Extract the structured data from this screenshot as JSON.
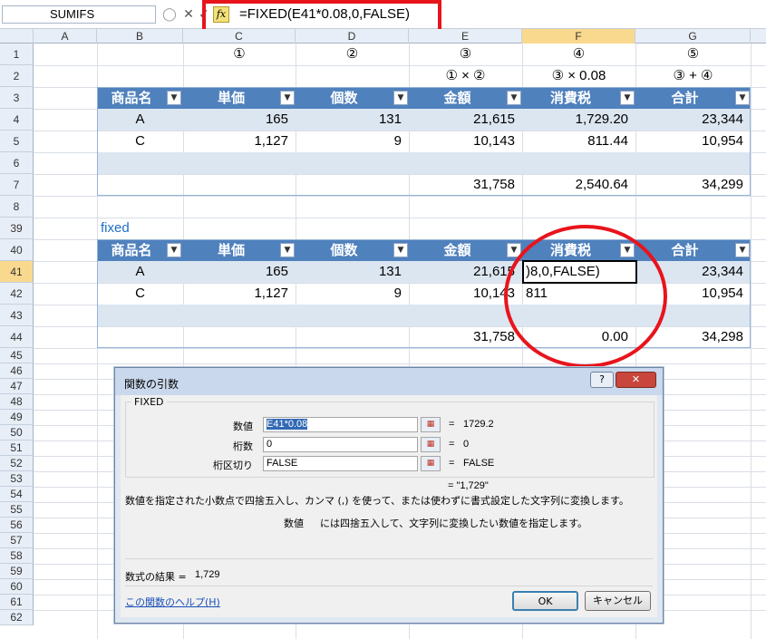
{
  "formula_bar": {
    "name_box": "SUMIFS",
    "cancel_icon": "✕",
    "enter_icon": "✓",
    "fx_label": "fx",
    "formula": "=FIXED(E41*0.08,0,FALSE)"
  },
  "columns": [
    "A",
    "B",
    "C",
    "D",
    "E",
    "F",
    "G"
  ],
  "rows": [
    "1",
    "2",
    "3",
    "4",
    "5",
    "6",
    "7",
    "8",
    "39",
    "40",
    "41",
    "42",
    "43",
    "44",
    "45",
    "46",
    "47",
    "48",
    "49",
    "50",
    "51",
    "52",
    "53",
    "54",
    "55",
    "56",
    "57",
    "58",
    "59",
    "60",
    "61",
    "62"
  ],
  "notes": {
    "row1": [
      "①",
      "②",
      "③",
      "④",
      "⑤"
    ],
    "row2": [
      "① × ②",
      "③ × 0.08",
      "③ + ④"
    ]
  },
  "table1": {
    "headers": [
      "商品名",
      "単価",
      "個数",
      "金額",
      "消費税",
      "合計"
    ],
    "rows": [
      [
        "A",
        "165",
        "131",
        "21,615",
        "1,729.20",
        "23,344"
      ],
      [
        "C",
        "1,127",
        "9",
        "10,143",
        "811.44",
        "10,954"
      ]
    ],
    "totals": [
      "31,758",
      "2,540.64",
      "34,299"
    ]
  },
  "section_label": "fixed",
  "table2": {
    "headers": [
      "商品名",
      "単価",
      "個数",
      "金額",
      "消費税",
      "合計"
    ],
    "rows": [
      [
        "A",
        "165",
        "131",
        "21,615",
        ")8,0,FALSE)",
        "23,344"
      ],
      [
        "C",
        "1,127",
        "9",
        "10,143",
        "811",
        "10,954"
      ]
    ],
    "totals": [
      "31,758",
      "0.00",
      "34,298"
    ]
  },
  "dialog": {
    "title": "関数の引数",
    "help_btn": "?",
    "close_btn": "✕",
    "function_name": "FIXED",
    "args": [
      {
        "label": "数値",
        "value": "E41*0.08",
        "result": "1729.2"
      },
      {
        "label": "桁数",
        "value": "0",
        "result": "0"
      },
      {
        "label": "桁区切り",
        "value": "FALSE",
        "result": "FALSE"
      }
    ],
    "formula_result_preview": "= \"1,729\"",
    "description": "数値を指定された小数点で四捨五入し、カンマ (,) を使って、または使わずに書式設定した文字列に変換します。",
    "arg_description_name": "数値",
    "arg_description": "には四捨五入して、文字列に変換したい数値を指定します。",
    "result_label": "数式の結果 =",
    "result_value": "1,729",
    "help_link": "この関数のヘルプ(H)",
    "ok": "OK",
    "cancel": "キャンセル"
  }
}
